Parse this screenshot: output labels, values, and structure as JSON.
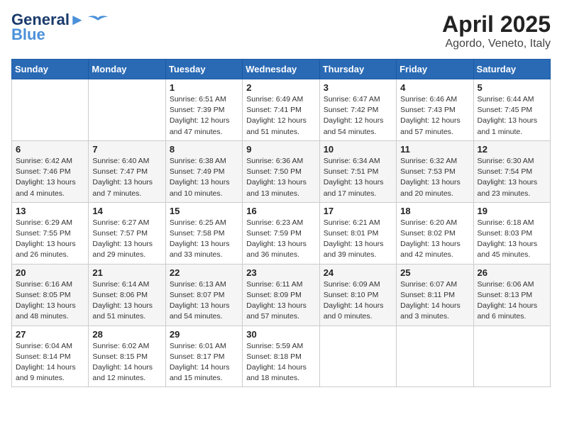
{
  "header": {
    "logo_line1": "General",
    "logo_line2": "Blue",
    "month": "April 2025",
    "location": "Agordo, Veneto, Italy"
  },
  "weekdays": [
    "Sunday",
    "Monday",
    "Tuesday",
    "Wednesday",
    "Thursday",
    "Friday",
    "Saturday"
  ],
  "weeks": [
    [
      {
        "day": null,
        "info": null
      },
      {
        "day": null,
        "info": null
      },
      {
        "day": "1",
        "info": "Sunrise: 6:51 AM\nSunset: 7:39 PM\nDaylight: 12 hours\nand 47 minutes."
      },
      {
        "day": "2",
        "info": "Sunrise: 6:49 AM\nSunset: 7:41 PM\nDaylight: 12 hours\nand 51 minutes."
      },
      {
        "day": "3",
        "info": "Sunrise: 6:47 AM\nSunset: 7:42 PM\nDaylight: 12 hours\nand 54 minutes."
      },
      {
        "day": "4",
        "info": "Sunrise: 6:46 AM\nSunset: 7:43 PM\nDaylight: 12 hours\nand 57 minutes."
      },
      {
        "day": "5",
        "info": "Sunrise: 6:44 AM\nSunset: 7:45 PM\nDaylight: 13 hours\nand 1 minute."
      }
    ],
    [
      {
        "day": "6",
        "info": "Sunrise: 6:42 AM\nSunset: 7:46 PM\nDaylight: 13 hours\nand 4 minutes."
      },
      {
        "day": "7",
        "info": "Sunrise: 6:40 AM\nSunset: 7:47 PM\nDaylight: 13 hours\nand 7 minutes."
      },
      {
        "day": "8",
        "info": "Sunrise: 6:38 AM\nSunset: 7:49 PM\nDaylight: 13 hours\nand 10 minutes."
      },
      {
        "day": "9",
        "info": "Sunrise: 6:36 AM\nSunset: 7:50 PM\nDaylight: 13 hours\nand 13 minutes."
      },
      {
        "day": "10",
        "info": "Sunrise: 6:34 AM\nSunset: 7:51 PM\nDaylight: 13 hours\nand 17 minutes."
      },
      {
        "day": "11",
        "info": "Sunrise: 6:32 AM\nSunset: 7:53 PM\nDaylight: 13 hours\nand 20 minutes."
      },
      {
        "day": "12",
        "info": "Sunrise: 6:30 AM\nSunset: 7:54 PM\nDaylight: 13 hours\nand 23 minutes."
      }
    ],
    [
      {
        "day": "13",
        "info": "Sunrise: 6:29 AM\nSunset: 7:55 PM\nDaylight: 13 hours\nand 26 minutes."
      },
      {
        "day": "14",
        "info": "Sunrise: 6:27 AM\nSunset: 7:57 PM\nDaylight: 13 hours\nand 29 minutes."
      },
      {
        "day": "15",
        "info": "Sunrise: 6:25 AM\nSunset: 7:58 PM\nDaylight: 13 hours\nand 33 minutes."
      },
      {
        "day": "16",
        "info": "Sunrise: 6:23 AM\nSunset: 7:59 PM\nDaylight: 13 hours\nand 36 minutes."
      },
      {
        "day": "17",
        "info": "Sunrise: 6:21 AM\nSunset: 8:01 PM\nDaylight: 13 hours\nand 39 minutes."
      },
      {
        "day": "18",
        "info": "Sunrise: 6:20 AM\nSunset: 8:02 PM\nDaylight: 13 hours\nand 42 minutes."
      },
      {
        "day": "19",
        "info": "Sunrise: 6:18 AM\nSunset: 8:03 PM\nDaylight: 13 hours\nand 45 minutes."
      }
    ],
    [
      {
        "day": "20",
        "info": "Sunrise: 6:16 AM\nSunset: 8:05 PM\nDaylight: 13 hours\nand 48 minutes."
      },
      {
        "day": "21",
        "info": "Sunrise: 6:14 AM\nSunset: 8:06 PM\nDaylight: 13 hours\nand 51 minutes."
      },
      {
        "day": "22",
        "info": "Sunrise: 6:13 AM\nSunset: 8:07 PM\nDaylight: 13 hours\nand 54 minutes."
      },
      {
        "day": "23",
        "info": "Sunrise: 6:11 AM\nSunset: 8:09 PM\nDaylight: 13 hours\nand 57 minutes."
      },
      {
        "day": "24",
        "info": "Sunrise: 6:09 AM\nSunset: 8:10 PM\nDaylight: 14 hours\nand 0 minutes."
      },
      {
        "day": "25",
        "info": "Sunrise: 6:07 AM\nSunset: 8:11 PM\nDaylight: 14 hours\nand 3 minutes."
      },
      {
        "day": "26",
        "info": "Sunrise: 6:06 AM\nSunset: 8:13 PM\nDaylight: 14 hours\nand 6 minutes."
      }
    ],
    [
      {
        "day": "27",
        "info": "Sunrise: 6:04 AM\nSunset: 8:14 PM\nDaylight: 14 hours\nand 9 minutes."
      },
      {
        "day": "28",
        "info": "Sunrise: 6:02 AM\nSunset: 8:15 PM\nDaylight: 14 hours\nand 12 minutes."
      },
      {
        "day": "29",
        "info": "Sunrise: 6:01 AM\nSunset: 8:17 PM\nDaylight: 14 hours\nand 15 minutes."
      },
      {
        "day": "30",
        "info": "Sunrise: 5:59 AM\nSunset: 8:18 PM\nDaylight: 14 hours\nand 18 minutes."
      },
      {
        "day": null,
        "info": null
      },
      {
        "day": null,
        "info": null
      },
      {
        "day": null,
        "info": null
      }
    ]
  ]
}
